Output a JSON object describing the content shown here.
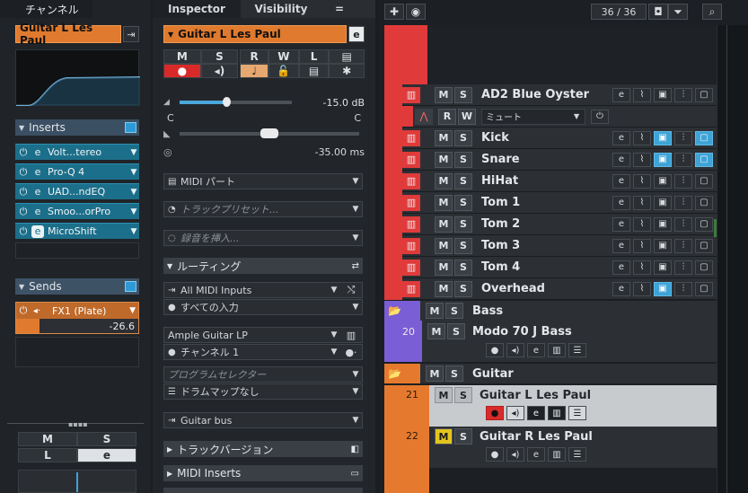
{
  "channel": {
    "tab_label": "チャンネル",
    "track_name": "Guitar L Les Paul",
    "inserts_label": "Inserts",
    "inserts": [
      "Volt...tereo",
      "Pro-Q 4",
      "UAD...ndEQ",
      "Smoo...orPro",
      "MicroShift"
    ],
    "sends_label": "Sends",
    "send": {
      "name": "FX1 (Plate)",
      "value": "-26.6"
    },
    "bottom_buttons": {
      "m": "M",
      "s": "S",
      "l": "L",
      "e": "e"
    }
  },
  "inspector": {
    "tabs": [
      "Inspector",
      "Visibility"
    ],
    "menu_icon": "=",
    "track_name": "Guitar L Les Paul",
    "edit_icon": "e",
    "buttons_row1": [
      "M",
      "S",
      "R",
      "W",
      "L"
    ],
    "volume_value": "-15.0 dB",
    "pan_left": "C",
    "pan_right": "C",
    "delay_value": "-35.00 ms",
    "midi_part": "MIDI パート",
    "track_preset": "トラックプリセット...",
    "record_insert": "録音を挿入...",
    "routing_label": "ルーティング",
    "midi_input": "All MIDI Inputs",
    "input_channel": "すべての入力",
    "instrument": "Ample Guitar LP",
    "channel": "チャンネル 1",
    "program_selector": "プログラムセレクター",
    "drum_map": "ドラムマップなし",
    "output_bus": "Guitar bus",
    "track_versions_label": "トラックバージョン",
    "midi_inserts_label": "MIDI Inserts"
  },
  "tracklist": {
    "counter": "36 / 36",
    "tracks": [
      {
        "name": "AD2 Blue Oyster",
        "color": "#e03a3a"
      },
      {
        "name": "Kick",
        "color": "#e03a3a"
      },
      {
        "name": "Snare",
        "color": "#e03a3a"
      },
      {
        "name": "HiHat",
        "color": "#e03a3a"
      },
      {
        "name": "Tom 1",
        "color": "#e03a3a"
      },
      {
        "name": "Tom 2",
        "color": "#e03a3a"
      },
      {
        "name": "Tom 3",
        "color": "#e03a3a"
      },
      {
        "name": "Tom 4",
        "color": "#e03a3a"
      },
      {
        "name": "Overhead",
        "color": "#e03a3a"
      }
    ],
    "automation_lane": {
      "param": "ミュート",
      "r": "R",
      "w": "W"
    },
    "folders": {
      "bass": {
        "name": "Bass",
        "color": "#7a5ed6"
      },
      "guitar": {
        "name": "Guitar",
        "color": "#e57a2e"
      }
    },
    "bass_track": {
      "number": "20",
      "name": "Modo 70 J Bass"
    },
    "guitar_tracks": [
      {
        "number": "21",
        "name": "Guitar L Les Paul"
      },
      {
        "number": "22",
        "name": "Guitar R Les Paul"
      }
    ]
  },
  "colors": {
    "accent_orange": "#e07a2e",
    "accent_blue": "#3ea3d6",
    "record_red": "#e02a2a",
    "solo_yellow": "#e3c51e"
  }
}
